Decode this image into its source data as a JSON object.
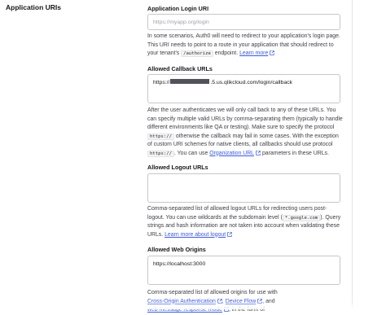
{
  "section": {
    "title": "Application URIs"
  },
  "login_uri": {
    "label": "Application Login URI",
    "placeholder": "https://myapp.org/login",
    "help_1": "In some scenarios, Auth0 will need to redirect to your application's login page. This URI needs to point to a route in your application that should redirect to your tenant's",
    "help_code": "/authorize",
    "help_2": " endpoint.",
    "learn_more": "Learn more"
  },
  "callback_urls": {
    "label": "Allowed Callback URLs",
    "value_prefix": "https://",
    "value_suffix": ".5.us.qlikcloud.com/login/callback",
    "help_1": "After the user authenticates we will only call back to any of these URLs. You can specify multiple valid URLs by comma-separating them (typically to handle different environments like QA or testing). Make sure to specify the protocol",
    "help_code_1": "https://",
    "help_2": " otherwise the callback may fail in some cases. With the exception of custom URI schemes for native clients, all callbacks should use protocol",
    "help_code_2": "https://",
    "help_3": ". You can use ",
    "help_link": "Organization URL",
    "help_4": " parameters in these URLs."
  },
  "logout_urls": {
    "label": "Allowed Logout URLs",
    "value": "",
    "help_1": "Comma-separated list of allowed logout URLs for redirecting users post-logout. You can use wildcards at the subdomain level (",
    "help_code": "*.google.com",
    "help_2": "). Query strings and hash information are not taken into account when validating these URLs.",
    "learn_more": "Learn more about logout"
  },
  "web_origins": {
    "label": "Allowed Web Origins",
    "value": "https://localhost:3000",
    "help_1": "Comma-separated list of allowed origins for use with",
    "link_1": "Cross-Origin Authentication",
    "sep": ", ",
    "link_2": "Device Flow",
    "help_2": ", and",
    "link_3": "web message response mode",
    "help_3": ", in the form of"
  },
  "colors": {
    "link": "#3b5bdb",
    "border": "#c7c7cd",
    "text": "#3f3f46"
  },
  "icons": {
    "external_link": "external-link-icon"
  }
}
